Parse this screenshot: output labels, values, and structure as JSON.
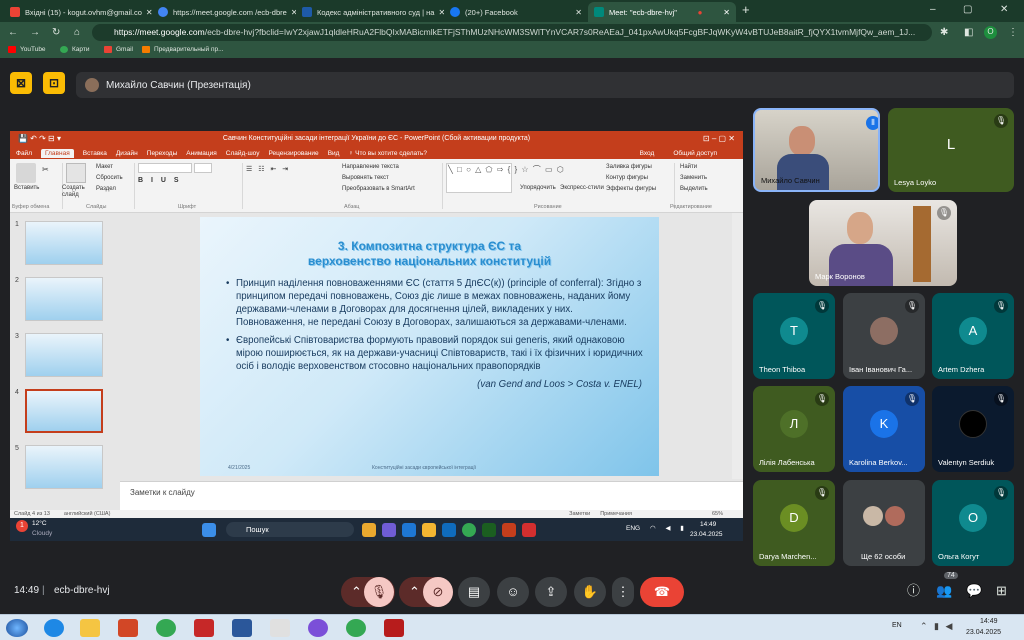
{
  "browser": {
    "tabs": [
      {
        "title": "Вхідні (15) - kogut.ovhm@gmail.co",
        "active": false,
        "color": "#ea4335"
      },
      {
        "title": "https://meet.google.com /ecb-dbre",
        "active": false,
        "color": "#4285f4"
      },
      {
        "title": "Кодекс адміністративного суд | на",
        "active": false,
        "color": "#1e5aa8"
      },
      {
        "title": "(20+) Facebook",
        "active": false,
        "color": "#1877f2"
      },
      {
        "title": "Meet: \"ecb-dbre-hvj\"",
        "active": true,
        "color": "#00897b"
      }
    ],
    "url_host": "https://meet.google.com",
    "url_path": "/ecb-dbre-hvj?fbclid=IwY2xjawJ1qldleHRuA2FlbQIxMABicmlkETFjSThMUzNHcWM3SWlTYnVCAR7s0ReAEaJ_041pxAwUkq5FcgBFJqWKyW4vBTUJeB8aitR_fjQYX1tvmMjfQw_aem_1J...",
    "bookmarks": [
      "YouTube",
      "Карти",
      "Gmail",
      "Предварительный пр..."
    ],
    "profile_badge": "O"
  },
  "meet": {
    "presenter_label": "Михайло Савчин (Презентація)",
    "clock": "14:49",
    "meeting_code": "ecb-dbre-hvj",
    "people_count": "74",
    "participants": [
      {
        "name": "Михайло Савчин",
        "initial": "",
        "kind": "video"
      },
      {
        "name": "Lesya Loyko",
        "initial": "L",
        "kind": "olive"
      },
      {
        "name": "Марк Воронов",
        "initial": "",
        "kind": "video2"
      },
      {
        "name": "Theon Thiboa",
        "initial": "T",
        "kind": "teal"
      },
      {
        "name": "Іван Іванович Га...",
        "initial": "",
        "kind": "photo"
      },
      {
        "name": "Artem Dzhera",
        "initial": "A",
        "kind": "teal"
      },
      {
        "name": "Лілія Лабенська",
        "initial": "Л",
        "kind": "olive"
      },
      {
        "name": "Karolina Berkov...",
        "initial": "K",
        "kind": "navy"
      },
      {
        "name": "Valentyn Serdiuk",
        "initial": "",
        "kind": "photo2"
      },
      {
        "name": "Darya Marchen...",
        "initial": "D",
        "kind": "olive"
      },
      {
        "name": "Ще 62 особи",
        "initial": "",
        "kind": "more"
      },
      {
        "name": "Ольга Когут",
        "initial": "O",
        "kind": "teal"
      }
    ]
  },
  "ppt": {
    "title": "Савчин Конституційні засади інтеграції України до ЄС - PowerPoint (Сбой активации продукта)",
    "tabs": [
      "Файл",
      "Главная",
      "Вставка",
      "Дизайн",
      "Переходы",
      "Анимация",
      "Слайд-шоу",
      "Рецензирование",
      "Вид",
      "♀ Что вы хотите сделать?"
    ],
    "tabs_right": [
      "Вход",
      "Общий доступ"
    ],
    "ribbon": {
      "paste": "Вставить",
      "create_slide": "Создать слайд",
      "cut": "Макет",
      "reset": "Сбросить",
      "section": "Раздел",
      "text_dir": "Направление текста",
      "align_text": "Выровнять текст",
      "smartart": "Преобразовать в SmartArt",
      "arrange": "Упорядочить",
      "quick_styles": "Экспресс-стили",
      "fill": "Заливка фигуры",
      "outline": "Контур фигуры",
      "effects": "Эффекты фигуры",
      "find": "Найти",
      "replace": "Заменить",
      "select": "Выделить",
      "groups": [
        "Буфер обмена",
        "Слайды",
        "Шрифт",
        "Абзац",
        "Рисование",
        "Редактирование"
      ]
    },
    "thumb_numbers": [
      "1",
      "2",
      "3",
      "4",
      "5"
    ],
    "slide": {
      "title_line1": "3. Композитна структура ЄС та",
      "title_line2": "верховенство національних конституцій",
      "bullet1": "Принцип наділення повноваженнями ЄС (стаття 5 ДпЄС(к)) (principle of conferral): Згідно з принципом передачі повноважень, Союз діє лише в межах повноважень, наданих йому державами-членами в Договорах для досягнення цілей, викладених у них. Повноваження, не передані Союзу в Договорах, залишаються за державами-членами.",
      "bullet2": "Європейські Співтовариства формують правовий порядок sui generis, який однаковою мірою поширюється, як на держави-учасниці Співтовариств, такі і їх фізичних і юридичних осіб і володіє верховенством стосовно національних правопорядків",
      "ref": "(van Gend and Loos > Costa v. ENEL)",
      "footer_date": "4/21/2025",
      "footer_center": "Конституційні засади європейської інтеграції"
    },
    "notes_placeholder": "Заметки к слайду",
    "status_left": "Слайд 4 из 13",
    "status_lang": "английский (США)",
    "status_notes": "Заметки",
    "status_comments": "Примечания",
    "zoom": "65%",
    "taskbar_search": "Пошук",
    "weather": "12°C",
    "weather_desc": "Cloudy",
    "lang": "ENG",
    "time": "14:49",
    "date": "23.04.2025"
  },
  "os": {
    "lang": "EN",
    "time": "14:49",
    "date": "23.04.2025"
  }
}
